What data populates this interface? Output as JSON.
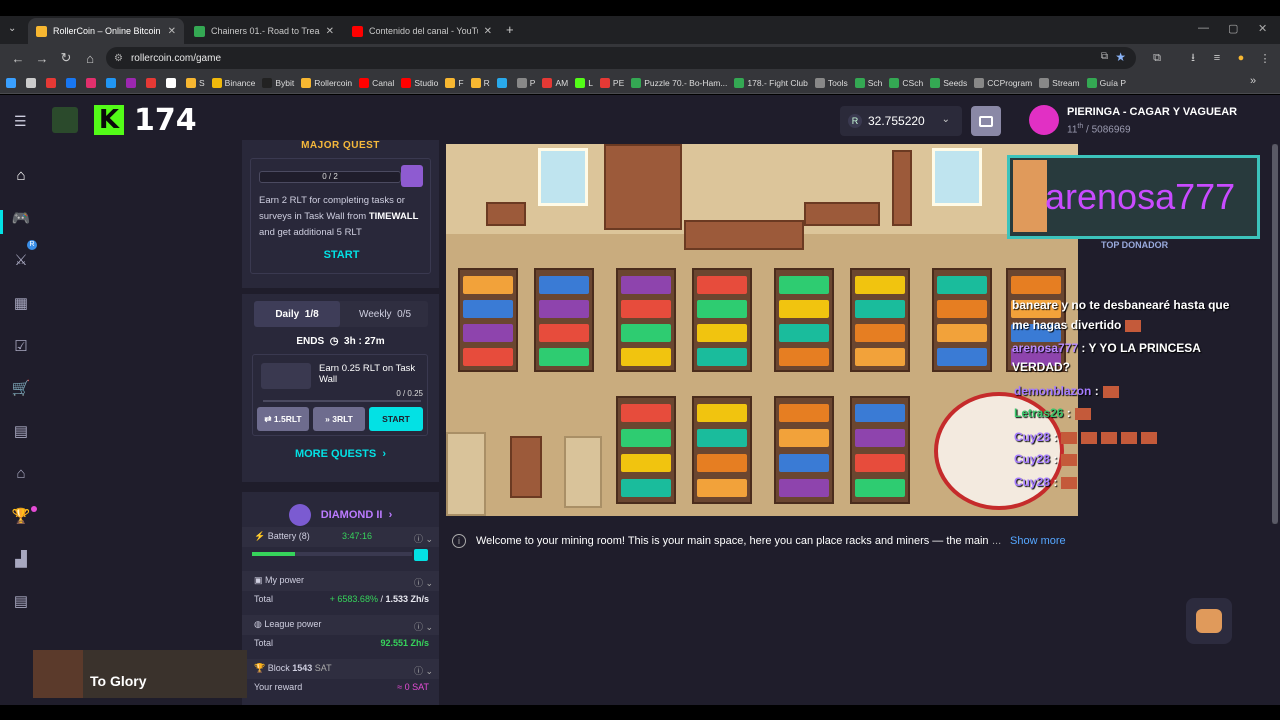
{
  "browser": {
    "tabs": [
      {
        "title": "RollerCoin – Online Bitcoin Mining",
        "active": true,
        "color": "#f7b731"
      },
      {
        "title": "Chainers 01.- Road to Treasure",
        "active": false,
        "color": "#34a853"
      },
      {
        "title": "Contenido del canal - YouTube",
        "active": false,
        "color": "#ff0000"
      }
    ],
    "new_tab_label": "+",
    "url": "rollercoin.com/game",
    "bookmarks": [
      {
        "label": "",
        "color": "#3aa0ff"
      },
      {
        "label": "",
        "color": "#cccccc"
      },
      {
        "label": "",
        "color": "#e53935"
      },
      {
        "label": "",
        "color": "#1877f2"
      },
      {
        "label": "",
        "color": "#e1306c"
      },
      {
        "label": "",
        "color": "#2196f3"
      },
      {
        "label": "",
        "color": "#9c27b0"
      },
      {
        "label": "",
        "color": "#e53935"
      },
      {
        "label": "",
        "color": "#ffffff"
      },
      {
        "label": "S",
        "color": "#f7b731"
      },
      {
        "label": "Binance",
        "color": "#f0b90b"
      },
      {
        "label": "Bybit",
        "color": "#222222"
      },
      {
        "label": "Rollercoin",
        "color": "#f7b731"
      },
      {
        "label": "Canal",
        "color": "#ff0000"
      },
      {
        "label": "Studio",
        "color": "#ff0000"
      },
      {
        "label": "F",
        "color": "#f7b731"
      },
      {
        "label": "R",
        "color": "#f7b731"
      },
      {
        "label": "",
        "color": "#29a9eb"
      },
      {
        "label": "P",
        "color": "#888888"
      },
      {
        "label": "AM",
        "color": "#e53935"
      },
      {
        "label": "L",
        "color": "#53fc18"
      },
      {
        "label": "PE",
        "color": "#e53935"
      },
      {
        "label": "Puzzle 70.- Bo-Ham...",
        "color": "#34a853"
      },
      {
        "label": "178.- Fight Club",
        "color": "#34a853"
      },
      {
        "label": "Tools",
        "color": "#888888"
      },
      {
        "label": "Sch",
        "color": "#34a853"
      },
      {
        "label": "CSch",
        "color": "#34a853"
      },
      {
        "label": "Seeds",
        "color": "#34a853"
      },
      {
        "label": "CCProgram",
        "color": "#888888"
      },
      {
        "label": "Stream",
        "color": "#888888"
      },
      {
        "label": "Guía P",
        "color": "#34a853"
      }
    ],
    "more_bookmarks": "»"
  },
  "header": {
    "menu_icon": "hamburger-icon",
    "kick_logo": "K",
    "kick_viewers": "174",
    "balance_prefix": "R",
    "balance": "32.755220",
    "profile_name": "PIERINGA - CAGAR Y VAGUEAR",
    "profile_rank_place": "11",
    "profile_rank_sup": "th",
    "profile_rank_total": "5086969"
  },
  "sidenav": {
    "items": [
      {
        "name": "home",
        "glyph": "⌂"
      },
      {
        "name": "games",
        "glyph": "🎮"
      },
      {
        "name": "pvp",
        "glyph": "⚔"
      },
      {
        "name": "inventory",
        "glyph": "▦"
      },
      {
        "name": "tasks",
        "glyph": "☑"
      },
      {
        "name": "marketplace",
        "glyph": "🛒"
      },
      {
        "name": "store",
        "glyph": "▤"
      },
      {
        "name": "hall",
        "glyph": "⌂"
      },
      {
        "name": "leaderboard",
        "glyph": "🏆"
      },
      {
        "name": "factory",
        "glyph": "▟"
      },
      {
        "name": "news",
        "glyph": "▤"
      }
    ],
    "badge_r": "R"
  },
  "quest": {
    "title": "MAJOR QUEST",
    "progress": "0 / 2",
    "text_prefix": "Earn 2 RLT for completing tasks or surveys in Task Wall from ",
    "text_brand": "TIMEWALL",
    "text_suffix": " and get additional 5 RLT",
    "start": "START"
  },
  "daily": {
    "tab_daily": "Daily",
    "tab_daily_count": "1/8",
    "tab_weekly": "Weekly",
    "tab_weekly_count": "0/5",
    "ends_label": "ENDS",
    "ends_time": "3h : 27m",
    "task_text": "Earn 0.25 RLT on Task Wall",
    "task_progress": "0 / 0.25",
    "task_progress_fraction": 0,
    "btn_reroll": "1.5RLT",
    "btn_skip": "3RLT",
    "btn_start": "START",
    "more_quests": "MORE QUESTS"
  },
  "stats": {
    "league": "DIAMOND II",
    "battery_label": "Battery (8)",
    "battery_time": "3:47:16",
    "battery_level": 0.27,
    "my_power_label": "My power",
    "total_label": "Total",
    "my_power_bonus": "+ 6583.68%",
    "my_power_value": "1.533 Zh/s",
    "league_power_label": "League power",
    "league_total_label": "Total",
    "league_power_value": "92.551 Zh/s",
    "block_label": "Block",
    "block_number": "1543",
    "block_currency": "SAT",
    "reward_label": "Your reward",
    "reward_value": "≈ 0 SAT"
  },
  "video": {
    "title": "To Glory"
  },
  "overlay": {
    "donor_name": "arenosa777",
    "donor_label": "TOP DONADOR",
    "chat": [
      {
        "name": "",
        "text": "baneare y no te desbanearé hasta que"
      },
      {
        "name": "",
        "text": "me hagas divertido"
      },
      {
        "name": "arenosa777",
        "text": ": Y YO LA PRINCESA"
      },
      {
        "name": "",
        "text": "VERDAD?"
      },
      {
        "name": "demonblazon",
        "text": ":"
      },
      {
        "name": "Letras26",
        "text": ":"
      },
      {
        "name": "Cuy28",
        "text": ":"
      },
      {
        "name": "Cuy28",
        "text": ":"
      },
      {
        "name": "Cuy28",
        "text": ":"
      }
    ]
  },
  "info": {
    "text": "Welcome to your mining room! This is your main space, here you can place racks and miners — the main",
    "ellipsis": "...",
    "show_more": "Show more"
  }
}
